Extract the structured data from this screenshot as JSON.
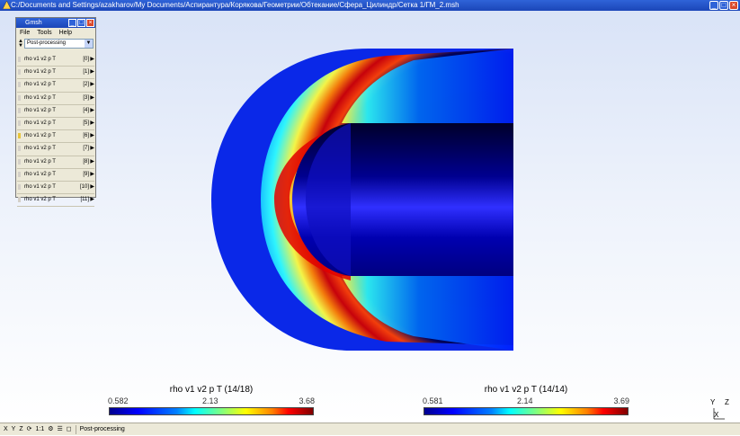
{
  "window": {
    "title": "C:/Documents and Settings/azakharov/My Documents/Аспирантура/Корякова/Геометрии/Обтекание/Сфера_Цилиндр/Сетка 1/ГМ_2.msh"
  },
  "panel": {
    "title": "Gmsh",
    "menu": [
      "File",
      "Tools",
      "Help"
    ],
    "module_select": "Post-processing",
    "views": [
      {
        "label": "rho v1 v2 p T",
        "index": "[0]",
        "checked": false
      },
      {
        "label": "rho v1 v2 p T",
        "index": "[1]",
        "checked": false
      },
      {
        "label": "rho v1 v2 p T",
        "index": "[2]",
        "checked": false
      },
      {
        "label": "rho v1 v2 p T",
        "index": "[3]",
        "checked": false
      },
      {
        "label": "rho v1 v2 p T",
        "index": "[4]",
        "checked": false
      },
      {
        "label": "rho v1 v2 p T",
        "index": "[5]",
        "checked": false
      },
      {
        "label": "rho v1 v2 p T",
        "index": "[6]",
        "checked": true
      },
      {
        "label": "rho v1 v2 p T",
        "index": "[7]",
        "checked": false
      },
      {
        "label": "rho v1 v2 p T",
        "index": "[8]",
        "checked": false
      },
      {
        "label": "rho v1 v2 p T",
        "index": "[9]",
        "checked": false
      },
      {
        "label": "rho v1 v2 p T",
        "index": "[10]",
        "checked": false
      },
      {
        "label": "rho v1 v2 p T",
        "index": "[11]",
        "checked": false
      }
    ]
  },
  "colorbars": [
    {
      "title": "rho v1 v2 p T (14/18)",
      "min": "0.582",
      "mid": "2.13",
      "max": "3.68"
    },
    {
      "title": "rho v1 v2 p T (14/14)",
      "min": "0.581",
      "mid": "2.14",
      "max": "3.69"
    }
  ],
  "axes": {
    "y": "Y",
    "z": "Z",
    "x": "X"
  },
  "statusbar": {
    "buttons": [
      "X",
      "Y",
      "Z",
      "1:1"
    ],
    "module": "Post-processing"
  }
}
